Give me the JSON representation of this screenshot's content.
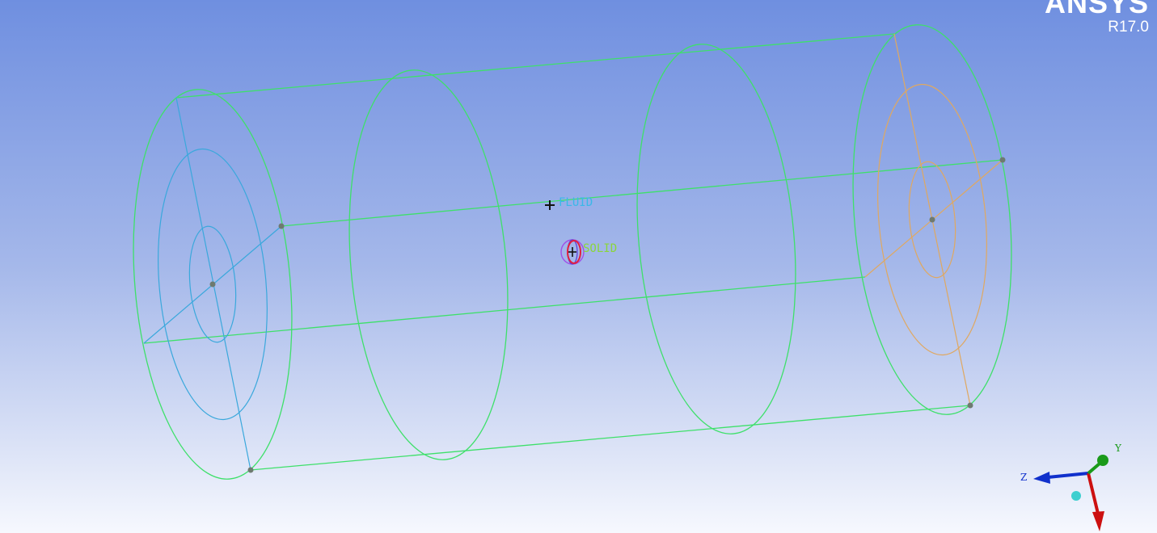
{
  "brand": {
    "name": "ANSYS",
    "version": "R17.0"
  },
  "bodies": {
    "fluid_label": "FLUID",
    "solid_label": "SOLID"
  },
  "triad": {
    "x_label": "",
    "y_label": "Y",
    "z_label": "Z"
  },
  "colors": {
    "fluid_wire": "#3ee06a",
    "inlet_wire": "#3aa8dc",
    "outlet_wire": "#e0a860",
    "fluid_text": "#3ab8e8",
    "solid_text": "#8ad63a",
    "vertex": "#6e7a70",
    "axis_x": "#cc1010",
    "axis_y": "#1a9a1a",
    "axis_z": "#1030cc",
    "axis_origin": "#3ecfcf"
  }
}
